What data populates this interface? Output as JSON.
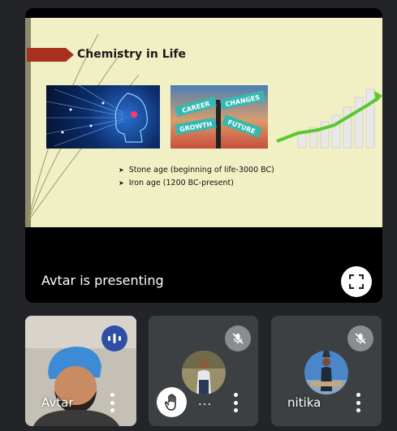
{
  "presentation": {
    "slide": {
      "title": "Chemistry in Life",
      "bullets": [
        "Stone age (beginning of life-3000 BC)",
        "Iron age (1200 BC-present)"
      ],
      "signpost_words": [
        "CAREER",
        "CHANGES",
        "GROWTH",
        "FUTURE"
      ]
    },
    "presenting_label": "Avtar is presenting",
    "colors": {
      "ribbon": "#a8301e",
      "slide_bg": "#f0f0c4"
    }
  },
  "participants": [
    {
      "name": "Avtar",
      "status": "speaking",
      "icon": "audio-wave-icon"
    },
    {
      "name": "...",
      "status": "muted",
      "icon": "mic-off-icon",
      "hand_raised": true
    },
    {
      "name": "nitika",
      "status": "muted",
      "icon": "mic-off-icon"
    }
  ]
}
